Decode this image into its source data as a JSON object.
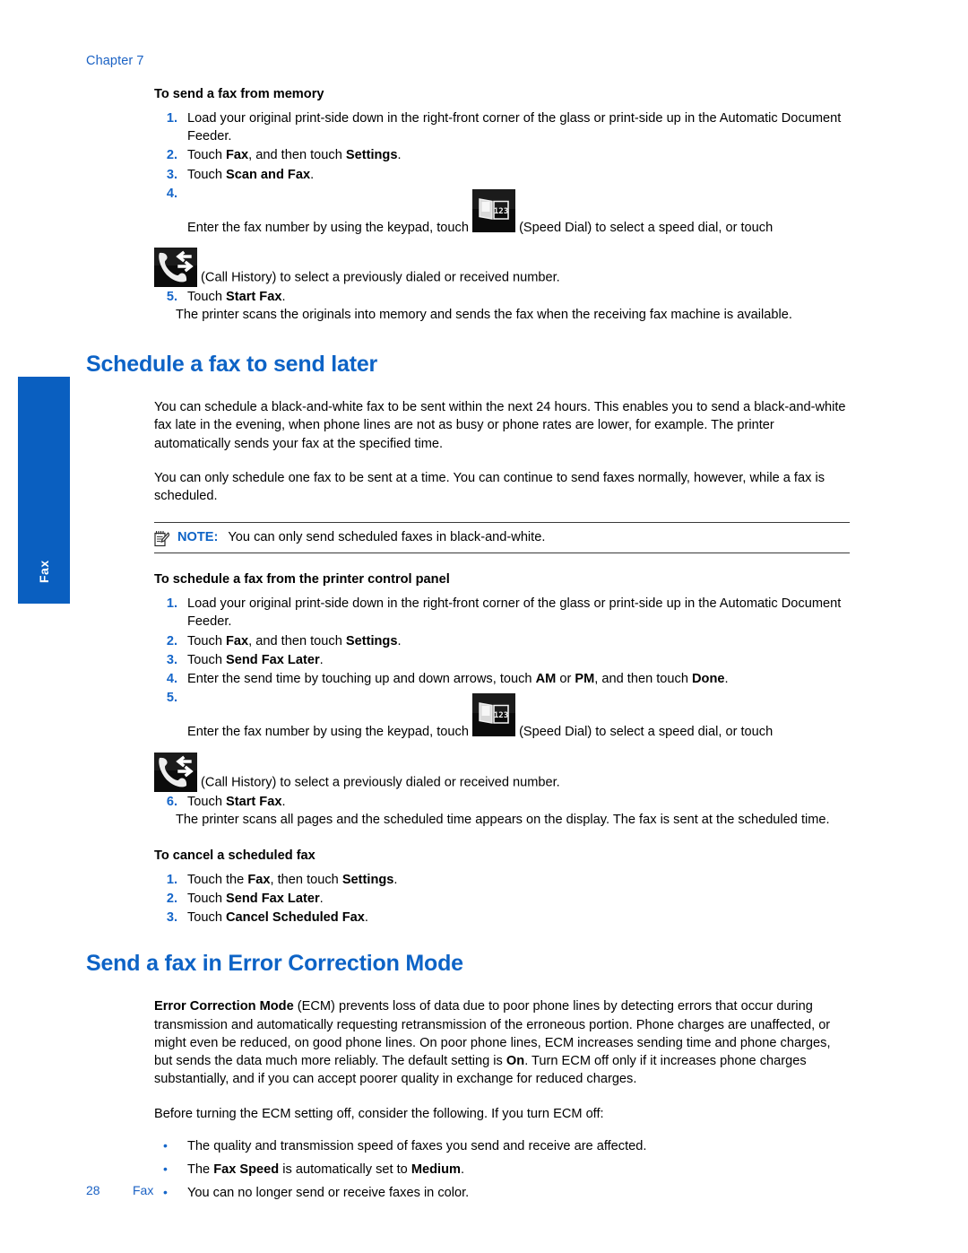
{
  "header": {
    "chapter": "Chapter 7"
  },
  "side_tab": {
    "label": "Fax",
    "color": "#0a5fc0"
  },
  "colors": {
    "heading_blue": "#0d63c6",
    "link_blue": "#1b62c4",
    "number_blue": "#1566c9"
  },
  "icons": {
    "speed_dial": "speed-dial-icon",
    "speed_dial_caption": "(Speed Dial)",
    "speed_dial_digits": "123",
    "call_history": "call-history-icon",
    "call_history_caption": "(Call History)",
    "note": "note-pad-pencil-icon"
  },
  "section_memory": {
    "proc_title": "To send a fax from memory",
    "steps": [
      {
        "num": "1.",
        "parts": [
          {
            "t": "Load your original print-side down in the right-front corner of the glass or print-side up in the Automatic Document Feeder.",
            "b": false
          }
        ]
      },
      {
        "num": "2.",
        "parts": [
          {
            "t": "Touch ",
            "b": false
          },
          {
            "t": "Fax",
            "b": true
          },
          {
            "t": ", and then touch ",
            "b": false
          },
          {
            "t": "Settings",
            "b": true
          },
          {
            "t": ".",
            "b": false
          }
        ]
      },
      {
        "num": "3.",
        "parts": [
          {
            "t": "Touch ",
            "b": false
          },
          {
            "t": "Scan and Fax",
            "b": true
          },
          {
            "t": ".",
            "b": false
          }
        ]
      },
      {
        "num": "4.",
        "icon_step": true,
        "line_a_pre": "Enter the fax number by using the keypad, touch ",
        "line_a_post": " (Speed Dial) to select a speed dial, or touch",
        "line_b_post": " (Call History) to select a previously dialed or received number."
      },
      {
        "num": "5.",
        "parts": [
          {
            "t": "Touch ",
            "b": false
          },
          {
            "t": "Start Fax",
            "b": true
          },
          {
            "t": ".",
            "b": false
          }
        ],
        "followup": "The printer scans the originals into memory and sends the fax when the receiving fax machine is available."
      }
    ]
  },
  "section_schedule": {
    "title": "Schedule a fax to send later",
    "para1": "You can schedule a black-and-white fax to be sent within the next 24 hours. This enables you to send a black-and-white fax late in the evening, when phone lines are not as busy or phone rates are lower, for example. The printer automatically sends your fax at the specified time.",
    "para2": "You can only schedule one fax to be sent at a time. You can continue to send faxes normally, however, while a fax is scheduled.",
    "note_label": "NOTE:",
    "note_text": "You can only send scheduled faxes in black-and-white.",
    "proc_title": "To schedule a fax from the printer control panel",
    "steps": [
      {
        "num": "1.",
        "parts": [
          {
            "t": "Load your original print-side down in the right-front corner of the glass or print-side up in the Automatic Document Feeder.",
            "b": false
          }
        ]
      },
      {
        "num": "2.",
        "parts": [
          {
            "t": "Touch ",
            "b": false
          },
          {
            "t": "Fax",
            "b": true
          },
          {
            "t": ", and then touch ",
            "b": false
          },
          {
            "t": "Settings",
            "b": true
          },
          {
            "t": ".",
            "b": false
          }
        ]
      },
      {
        "num": "3.",
        "parts": [
          {
            "t": "Touch ",
            "b": false
          },
          {
            "t": "Send Fax Later",
            "b": true
          },
          {
            "t": ".",
            "b": false
          }
        ]
      },
      {
        "num": "4.",
        "parts": [
          {
            "t": "Enter the send time by touching up and down arrows, touch ",
            "b": false
          },
          {
            "t": "AM",
            "b": true
          },
          {
            "t": " or ",
            "b": false
          },
          {
            "t": "PM",
            "b": true
          },
          {
            "t": ", and then touch ",
            "b": false
          },
          {
            "t": "Done",
            "b": true
          },
          {
            "t": ".",
            "b": false
          }
        ]
      },
      {
        "num": "5.",
        "icon_step": true,
        "line_a_pre": "Enter the fax number by using the keypad, touch ",
        "line_a_post": " (Speed Dial) to select a speed dial, or touch",
        "line_b_post": " (Call History) to select a previously dialed or received number."
      },
      {
        "num": "6.",
        "parts": [
          {
            "t": "Touch ",
            "b": false
          },
          {
            "t": "Start Fax",
            "b": true
          },
          {
            "t": ".",
            "b": false
          }
        ],
        "followup": "The printer scans all pages and the scheduled time appears on the display. The fax is sent at the scheduled time."
      }
    ],
    "cancel_title": "To cancel a scheduled fax",
    "cancel_steps": [
      {
        "num": "1.",
        "parts": [
          {
            "t": "Touch the ",
            "b": false
          },
          {
            "t": "Fax",
            "b": true
          },
          {
            "t": ", then touch ",
            "b": false
          },
          {
            "t": "Settings",
            "b": true
          },
          {
            "t": ".",
            "b": false
          }
        ]
      },
      {
        "num": "2.",
        "parts": [
          {
            "t": "Touch ",
            "b": false
          },
          {
            "t": "Send Fax Later",
            "b": true
          },
          {
            "t": ".",
            "b": false
          }
        ]
      },
      {
        "num": "3.",
        "parts": [
          {
            "t": "Touch ",
            "b": false
          },
          {
            "t": "Cancel Scheduled Fax",
            "b": true
          },
          {
            "t": ".",
            "b": false
          }
        ]
      }
    ]
  },
  "section_ecm": {
    "title": "Send a fax in Error Correction Mode",
    "para1_parts": [
      {
        "t": "Error Correction Mode",
        "b": true
      },
      {
        "t": " (ECM) prevents loss of data due to poor phone lines by detecting errors that occur during transmission and automatically requesting retransmission of the erroneous portion. Phone charges are unaffected, or might even be reduced, on good phone lines. On poor phone lines, ECM increases sending time and phone charges, but sends the data much more reliably. The default setting is ",
        "b": false
      },
      {
        "t": "On",
        "b": true
      },
      {
        "t": ". Turn ECM off only if it increases phone charges substantially, and if you can accept poorer quality in exchange for reduced charges.",
        "b": false
      }
    ],
    "para2": "Before turning the ECM setting off, consider the following. If you turn ECM off:",
    "bullets": [
      [
        {
          "t": "The quality and transmission speed of faxes you send and receive are affected.",
          "b": false
        }
      ],
      [
        {
          "t": "The ",
          "b": false
        },
        {
          "t": "Fax Speed",
          "b": true
        },
        {
          "t": " is automatically set to ",
          "b": false
        },
        {
          "t": "Medium",
          "b": true
        },
        {
          "t": ".",
          "b": false
        }
      ],
      [
        {
          "t": "You can no longer send or receive faxes in color.",
          "b": false
        }
      ]
    ]
  },
  "footer": {
    "page_number": "28",
    "section": "Fax"
  }
}
